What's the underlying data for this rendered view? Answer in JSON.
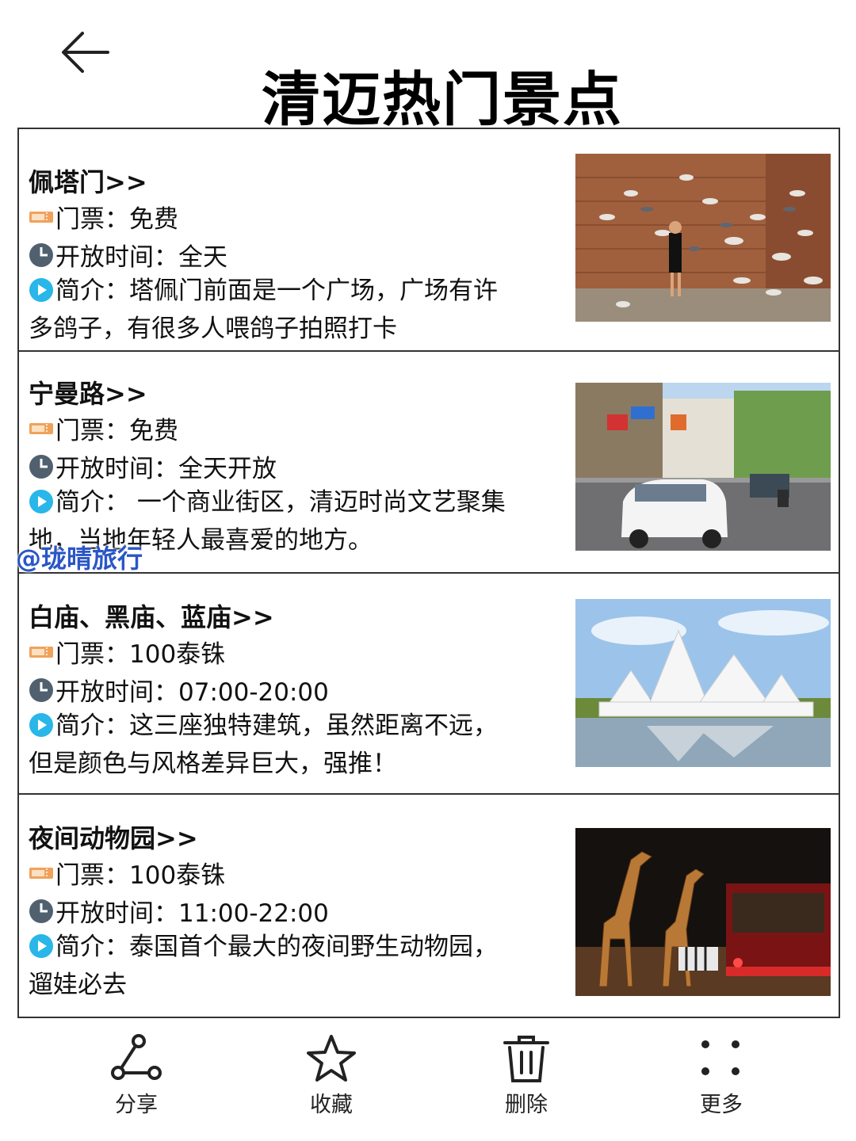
{
  "header": {
    "title": "清迈热门景点",
    "back_icon": "back-arrow-icon"
  },
  "spots": [
    {
      "title": "佩塔门>>",
      "ticket": "门票：免费",
      "hours": "开放时间：全天",
      "desc": "简介：塔佩门前面是一个广场，广场有许多鸽子，有很多人喂鸽子拍照打卡",
      "photo": "pigeons-at-brick-gate-photo"
    },
    {
      "title": "宁曼路>>",
      "ticket": "门票：免费",
      "hours": "开放时间：全天开放",
      "desc": "简介： 一个商业街区，清迈时尚文艺聚集地，当地年轻人最喜爱的地方。",
      "photo": "street-with-taxi-photo"
    },
    {
      "title": "白庙、黑庙、蓝庙>>",
      "ticket": "门票：100泰铢",
      "hours": "开放时间：07:00-20:00",
      "desc": "简介：这三座独特建筑，虽然距离不远，但是颜色与风格差异巨大，强推！",
      "photo": "white-temple-photo"
    },
    {
      "title": "夜间动物园>>",
      "ticket": "门票：100泰铢",
      "hours": "开放时间：11:00-22:00",
      "desc": "简介：泰国首个最大的夜间野生动物园，遛娃必去",
      "photo": "night-safari-giraffes-photo"
    }
  ],
  "watermark": "@珑晴旅行",
  "bottom_bar": {
    "share": "分享",
    "favorite": "收藏",
    "delete": "删除",
    "more": "更多"
  },
  "colors": {
    "ticket_icon": "#f0a25a",
    "clock_icon": "#50606e",
    "play_icon": "#29b6e8",
    "watermark": "#2a56c6"
  }
}
